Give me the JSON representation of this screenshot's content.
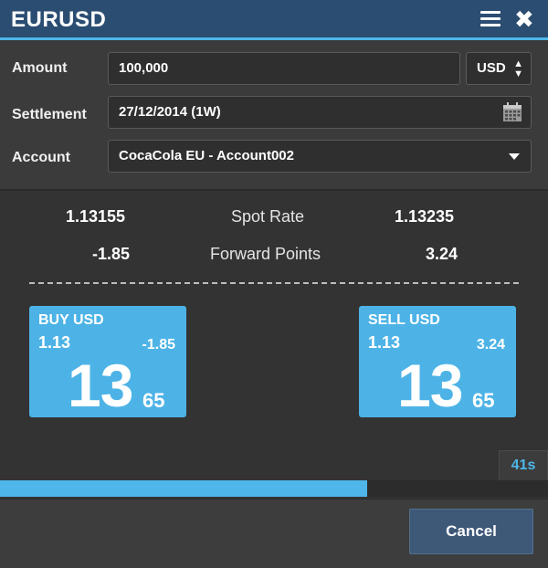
{
  "window": {
    "title": "EURUSD"
  },
  "form": {
    "amount": {
      "label": "Amount",
      "value": "100,000",
      "currency": "USD"
    },
    "settlement": {
      "label": "Settlement",
      "value": "27/12/2014 (1W)"
    },
    "account": {
      "label": "Account",
      "value": "CocaCola EU - Account002"
    }
  },
  "rates": {
    "spot": {
      "label": "Spot Rate",
      "bid": "1.13155",
      "ask": "1.13235"
    },
    "forward": {
      "label": "Forward Points",
      "bid": "-1.85",
      "ask": "3.24"
    }
  },
  "buy": {
    "label": "BUY USD",
    "big_figure": "1.13",
    "points": "-1.85",
    "pips": "13",
    "fraction": "65"
  },
  "sell": {
    "label": "SELL USD",
    "big_figure": "1.13",
    "points": "3.24",
    "pips": "13",
    "fraction": "65"
  },
  "timer": {
    "text": "41s",
    "progress_fraction": 0.67
  },
  "footer": {
    "cancel_label": "Cancel"
  },
  "colors": {
    "accent": "#4eb6e8",
    "titlebar": "#2b4d72",
    "trade_tile": "#4db3e6",
    "cancel": "#3e5878"
  },
  "icons": {
    "menu": "hamburger-menu-icon",
    "close": "close-icon",
    "calendar": "calendar-icon",
    "dropdown": "chevron-down-icon",
    "currency_toggle": "up-down-arrows-icon"
  }
}
